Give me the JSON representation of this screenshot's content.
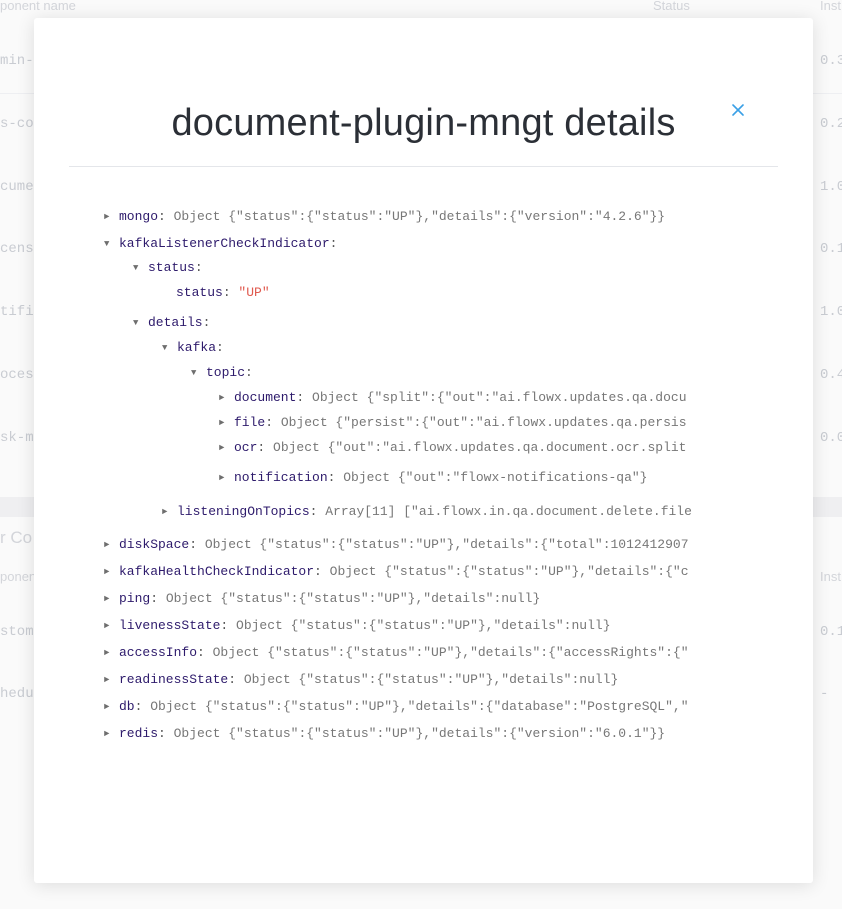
{
  "background": {
    "table1_header": {
      "component": "ponent name",
      "status": "Status",
      "instances": "Inst"
    },
    "table1_rows": [
      {
        "name": "min-",
        "inst": "0.3"
      },
      {
        "name": "s-co",
        "inst": "0.2"
      },
      {
        "name": "cume",
        "inst": "1.0"
      },
      {
        "name": "cens",
        "inst": "0.1"
      },
      {
        "name": "tifi",
        "inst": "1.0"
      },
      {
        "name": "oces",
        "inst": "0.4"
      },
      {
        "name": "sk-m",
        "inst": "0.0"
      }
    ],
    "section2_title": "r Co",
    "table2_header": {
      "component": "ponent",
      "instances": "Inst"
    },
    "table2_rows": [
      {
        "name": "stom",
        "inst": "0.1"
      },
      {
        "name": "hedu",
        "inst": "-"
      }
    ]
  },
  "modal": {
    "title": "document-plugin-mngt details",
    "close_icon": "close-icon",
    "accent_color": "#3aa0e6"
  },
  "tree": {
    "mongo": {
      "key": "mongo",
      "value": "Object {\"status\":{\"status\":\"UP\"},\"details\":{\"version\":\"4.2.6\"}}"
    },
    "kafkaListener": {
      "key": "kafkaListenerCheckIndicator"
    },
    "status": {
      "key": "status"
    },
    "status_inner": {
      "key": "status",
      "value": "\"UP\""
    },
    "details": {
      "key": "details"
    },
    "kafka": {
      "key": "kafka"
    },
    "topic": {
      "key": "topic"
    },
    "document": {
      "key": "document",
      "value": "Object {\"split\":{\"out\":\"ai.flowx.updates.qa.docu"
    },
    "file": {
      "key": "file",
      "value": "Object {\"persist\":{\"out\":\"ai.flowx.updates.qa.persis"
    },
    "ocr": {
      "key": "ocr",
      "value": "Object {\"out\":\"ai.flowx.updates.qa.document.ocr.split"
    },
    "notification": {
      "key": "notification",
      "value": "Object {\"out\":\"flowx-notifications-qa\"}"
    },
    "listeningOnTopics": {
      "key": "listeningOnTopics",
      "value": "Array[11] [\"ai.flowx.in.qa.document.delete.file"
    },
    "diskSpace": {
      "key": "diskSpace",
      "value": "Object {\"status\":{\"status\":\"UP\"},\"details\":{\"total\":1012412907"
    },
    "kafkaHealth": {
      "key": "kafkaHealthCheckIndicator",
      "value": "Object {\"status\":{\"status\":\"UP\"},\"details\":{\"c"
    },
    "ping": {
      "key": "ping",
      "value": "Object {\"status\":{\"status\":\"UP\"},\"details\":null}"
    },
    "livenessState": {
      "key": "livenessState",
      "value": "Object {\"status\":{\"status\":\"UP\"},\"details\":null}"
    },
    "accessInfo": {
      "key": "accessInfo",
      "value": "Object {\"status\":{\"status\":\"UP\"},\"details\":{\"accessRights\":{\""
    },
    "readinessState": {
      "key": "readinessState",
      "value": "Object {\"status\":{\"status\":\"UP\"},\"details\":null}"
    },
    "db": {
      "key": "db",
      "value": "Object {\"status\":{\"status\":\"UP\"},\"details\":{\"database\":\"PostgreSQL\",\""
    },
    "redis": {
      "key": "redis",
      "value": "Object {\"status\":{\"status\":\"UP\"},\"details\":{\"version\":\"6.0.1\"}}"
    }
  }
}
